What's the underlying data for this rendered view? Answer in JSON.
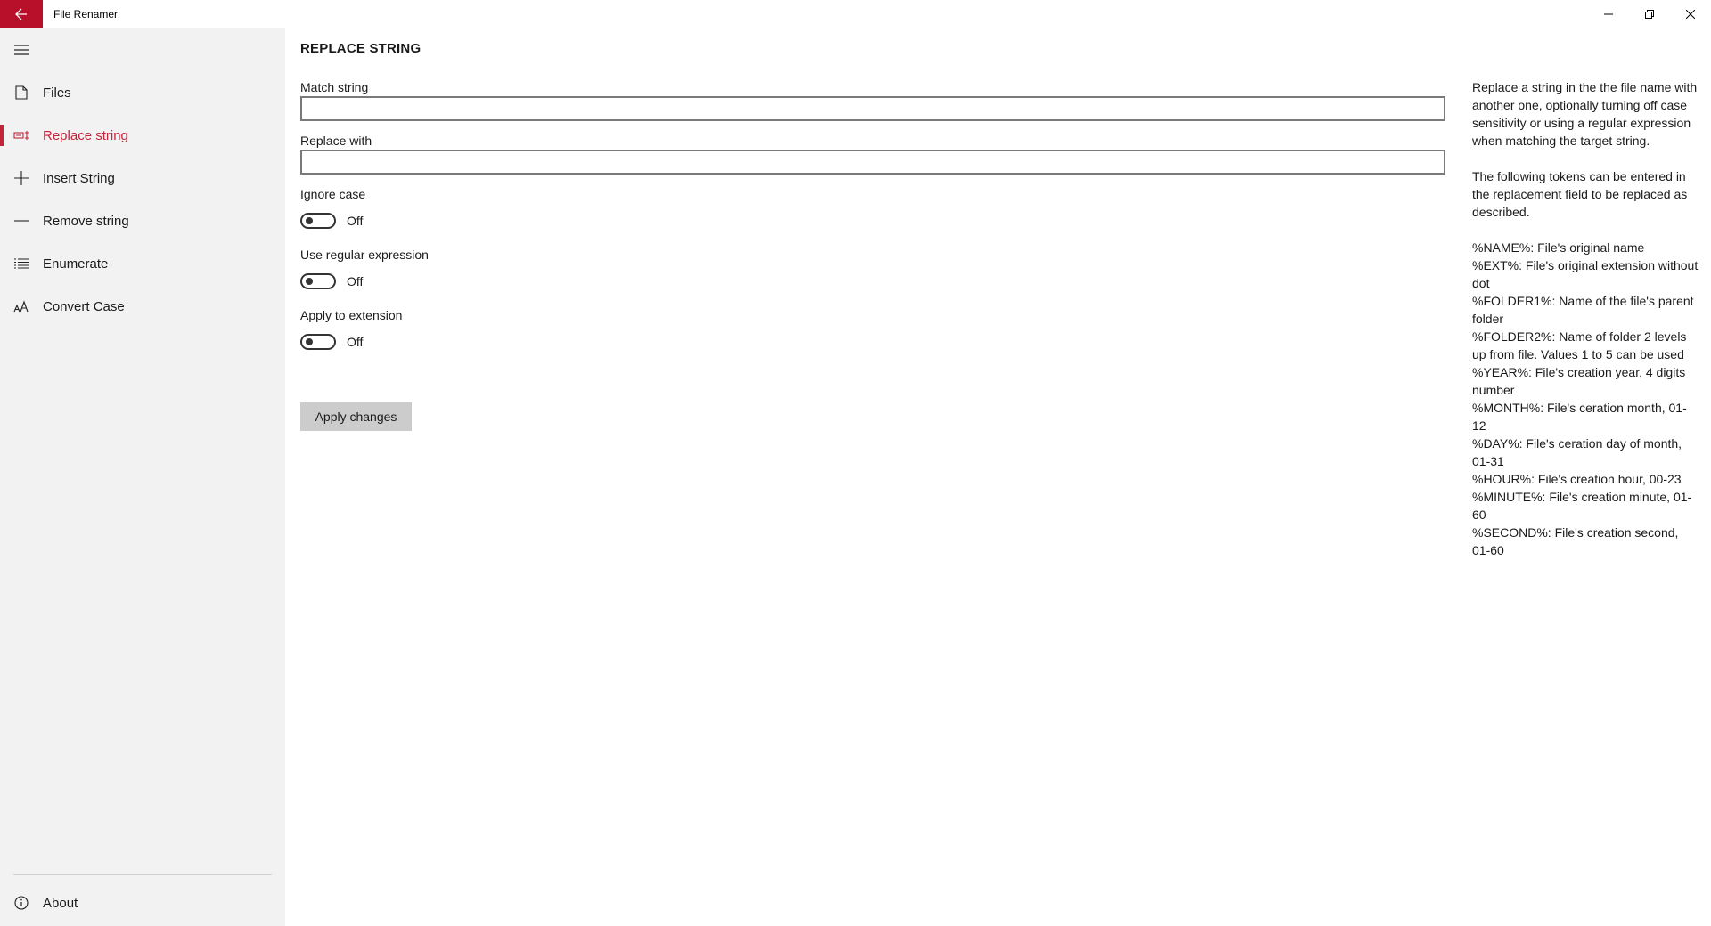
{
  "window": {
    "title": "File Renamer",
    "back_icon": "back-arrow-icon",
    "accent_color": "#b8102a"
  },
  "sidebar": {
    "menu_icon": "hamburger-icon",
    "items": [
      {
        "label": "Files",
        "icon": "file-icon"
      },
      {
        "label": "Replace string",
        "icon": "replace-icon"
      },
      {
        "label": "Insert String",
        "icon": "plus-icon"
      },
      {
        "label": "Remove string",
        "icon": "minus-icon"
      },
      {
        "label": "Enumerate",
        "icon": "list-icon"
      },
      {
        "label": "Convert Case",
        "icon": "font-case-icon"
      }
    ],
    "active_item": "Replace string",
    "footer": {
      "label": "About",
      "icon": "info-icon"
    }
  },
  "main": {
    "title": "REPLACE STRING",
    "match_label": "Match string",
    "match_value": "",
    "replace_label": "Replace with",
    "replace_value": "",
    "ignore_case_label": "Ignore case",
    "ignore_case_state": "Off",
    "regex_label": "Use regular expression",
    "regex_state": "Off",
    "extension_label": "Apply to extension",
    "extension_state": "Off",
    "apply_label": "Apply changes"
  },
  "help": {
    "description": "Replace a string in the the file name with another one, optionally turning off case sensitivity or using a regular expression when matching the target string.",
    "tokens_intro": "The following tokens can be entered in the replacement field to be replaced as described.",
    "tokens": [
      "%NAME%: File's original name",
      "%EXT%: File's original extension without dot",
      "%FOLDER1%: Name of the file's parent folder",
      "%FOLDER2%: Name of folder 2 levels up from file. Values 1 to 5 can be used",
      "%YEAR%: File's creation year, 4 digits number",
      "%MONTH%: File's ceration month, 01-12",
      "%DAY%: File's ceration day of month, 01-31",
      "%HOUR%: File's creation hour, 00-23",
      "%MINUTE%: File's creation minute, 01-60",
      "%SECOND%: File's creation second, 01-60"
    ]
  }
}
